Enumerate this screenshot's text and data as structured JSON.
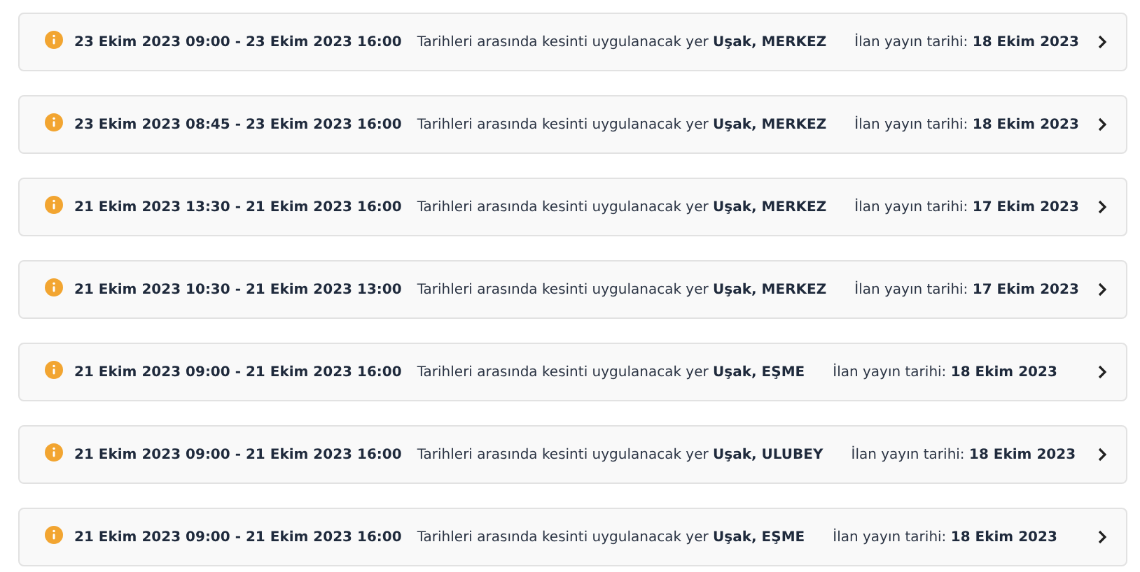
{
  "outages": [
    {
      "period": "23 Ekim 2023 09:00 - 23 Ekim 2023 16:00",
      "location": "Tarihleri arasında kesinti uygulanacak yer **Uşak, MERKEZ**",
      "published": "İlan yayın tarihi: **18 Ekim 2023**"
    },
    {
      "period": "23 Ekim 2023 08:45 - 23 Ekim 2023 16:00",
      "location": "Tarihleri arasında kesinti uygulanacak yer **Uşak, MERKEZ**",
      "published": "İlan yayın tarihi: **18 Ekim 2023**"
    },
    {
      "period": "21 Ekim 2023 13:30 - 21 Ekim 2023 16:00",
      "location": "Tarihleri arasında kesinti uygulanacak yer **Uşak, MERKEZ**",
      "published": "İlan yayın tarihi: **17 Ekim 2023**"
    },
    {
      "period": "21 Ekim 2023 10:30 - 21 Ekim 2023 13:00",
      "location": "Tarihleri arasında kesinti uygulanacak yer **Uşak, MERKEZ**",
      "published": "İlan yayın tarihi: **17 Ekim 2023**"
    },
    {
      "period": "21 Ekim 2023 09:00 - 21 Ekim 2023 16:00",
      "location": "Tarihleri arasında kesinti uygulanacak yer **Uşak, EŞME**",
      "published": "İlan yayın tarihi: **18 Ekim 2023**"
    },
    {
      "period": "21 Ekim 2023 09:00 - 21 Ekim 2023 16:00",
      "location": "Tarihleri arasında kesinti uygulanacak yer **Uşak, ULUBEY**",
      "published": "İlan yayın tarihi: **18 Ekim 2023**"
    },
    {
      "period": "21 Ekim 2023 09:00 - 21 Ekim 2023 16:00",
      "location": "Tarihleri arasında kesinti uygulanacak yer **Uşak, EŞME**",
      "published": "İlan yayın tarihi: **18 Ekim 2023**"
    }
  ]
}
